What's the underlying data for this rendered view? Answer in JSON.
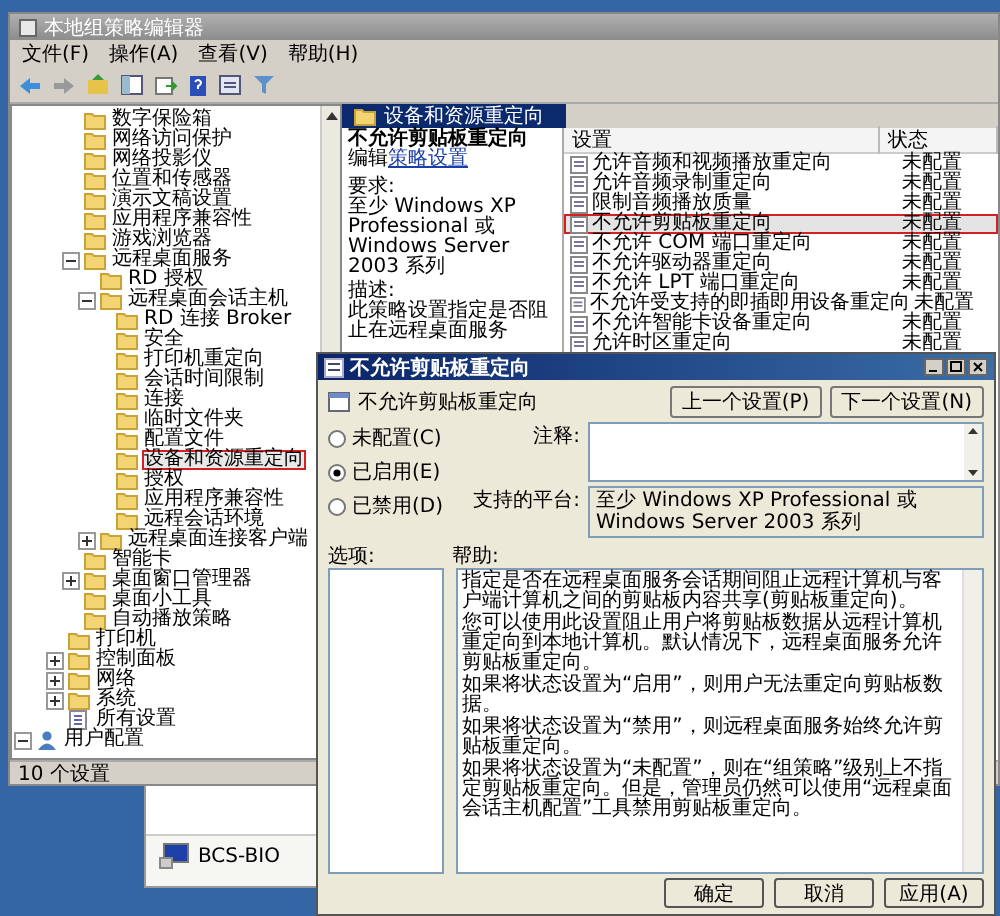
{
  "main_window": {
    "title": "本地组策略编辑器",
    "menu": [
      "文件(F)",
      "操作(A)",
      "查看(V)",
      "帮助(H)"
    ],
    "tree": {
      "components": [
        {
          "label": "数字保险箱",
          "selected": false
        },
        {
          "label": "网络访问保护",
          "selected": false
        },
        {
          "label": "网络投影仪",
          "selected": false
        },
        {
          "label": "位置和传感器",
          "selected": false
        },
        {
          "label": "演示文稿设置",
          "selected": false
        },
        {
          "label": "应用程序兼容性",
          "selected": false
        },
        {
          "label": "游戏浏览器",
          "selected": false
        },
        {
          "label": "远程桌面服务",
          "selected": false,
          "expanded": true,
          "children": [
            {
              "label": "RD 授权",
              "selected": false
            },
            {
              "label": "远程桌面会话主机",
              "selected": false,
              "expanded": true,
              "children": [
                {
                  "label": "RD 连接 Broker",
                  "selected": false
                },
                {
                  "label": "安全",
                  "selected": false
                },
                {
                  "label": "打印机重定向",
                  "selected": false
                },
                {
                  "label": "会话时间限制",
                  "selected": false
                },
                {
                  "label": "连接",
                  "selected": false
                },
                {
                  "label": "临时文件夹",
                  "selected": false
                },
                {
                  "label": "配置文件",
                  "selected": false
                },
                {
                  "label": "设备和资源重定向",
                  "selected": true
                },
                {
                  "label": "授权",
                  "selected": false
                },
                {
                  "label": "应用程序兼容性",
                  "selected": false
                },
                {
                  "label": "远程会话环境",
                  "selected": false
                }
              ]
            },
            {
              "label": "远程桌面连接客户端",
              "selected": false,
              "expanded": false
            }
          ]
        },
        {
          "label": "智能卡",
          "selected": false
        },
        {
          "label": "桌面窗口管理器",
          "selected": false,
          "expanded": false
        },
        {
          "label": "桌面小工具",
          "selected": false
        },
        {
          "label": "自动播放策略",
          "selected": false
        }
      ],
      "templates": [
        {
          "label": "打印机",
          "kind": "folder",
          "selected": false
        },
        {
          "label": "控制面板",
          "kind": "folder",
          "selected": false,
          "expanded": false
        },
        {
          "label": "网络",
          "kind": "folder",
          "selected": false,
          "expanded": false
        },
        {
          "label": "系统",
          "kind": "folder",
          "selected": false,
          "expanded": false
        },
        {
          "label": "所有设置",
          "kind": "settings",
          "selected": false
        }
      ],
      "roots": [
        {
          "label": "用户配置",
          "kind": "user",
          "selected": false,
          "expanded": true
        }
      ]
    },
    "details": {
      "header": "设备和资源重定向",
      "policy_title": "不允许剪贴板重定向",
      "edit_prefix": "编辑",
      "edit_link": "策略设置",
      "requirements_label": "要求:",
      "requirements": "至少 Windows XP Professional 或 Windows Server 2003 系列",
      "description_label": "描述:",
      "description": "此策略设置指定是否阻止在远程桌面服务"
    },
    "list": {
      "columns": [
        "设置",
        "状态"
      ],
      "rows": [
        {
          "name": "允许音频和视频播放重定向",
          "state": "未配置",
          "selected": false
        },
        {
          "name": "允许音频录制重定向",
          "state": "未配置",
          "selected": false
        },
        {
          "name": "限制音频播放质量",
          "state": "未配置",
          "selected": false
        },
        {
          "name": "不允许剪贴板重定向",
          "state": "未配置",
          "selected": true
        },
        {
          "name": "不允许 COM 端口重定向",
          "state": "未配置",
          "selected": false
        },
        {
          "name": "不允许驱动器重定向",
          "state": "未配置",
          "selected": false
        },
        {
          "name": "不允许 LPT 端口重定向",
          "state": "未配置",
          "selected": false
        },
        {
          "name": "不允许受支持的即插即用设备重定向",
          "state": "未配置",
          "selected": false
        },
        {
          "name": "不允许智能卡设备重定向",
          "state": "未配置",
          "selected": false
        },
        {
          "name": "允许时区重定向",
          "state": "未配置",
          "selected": false
        }
      ]
    },
    "status_bar": "10 个设置"
  },
  "background_window": {
    "computer": "BCS-BIO"
  },
  "dialog": {
    "title": "不允许剪贴板重定向",
    "setting_name": "不允许剪贴板重定向",
    "nav_buttons": [
      "上一个设置(P)",
      "下一个设置(N)"
    ],
    "options": [
      {
        "label": "未配置(C)",
        "selected": false
      },
      {
        "label": "已启用(E)",
        "selected": true
      },
      {
        "label": "已禁用(D)",
        "selected": false
      }
    ],
    "comment_label": "注释:",
    "platform_label": "支持的平台:",
    "platform": "至少 Windows XP Professional 或 Windows Server 2003 系列",
    "options_label": "选项:",
    "help_label": "帮助:",
    "help": [
      "指定是否在远程桌面服务会话期间阻止远程计算机与客户端计算机之间的剪贴板内容共享(剪贴板重定向)。",
      "您可以使用此设置阻止用户将剪贴板数据从远程计算机重定向到本地计算机。默认情况下，远程桌面服务允许剪贴板重定向。",
      "如果将状态设置为“启用”，则用户无法重定向剪贴板数据。",
      "如果将状态设置为“禁用”，则远程桌面服务始终允许剪贴板重定向。",
      "如果将状态设置为“未配置”，则在“组策略”级别上不指定剪贴板重定向。但是，管理员仍然可以使用“远程桌面会话主机配置”工具禁用剪贴板重定向。"
    ],
    "buttons": [
      "确定",
      "取消",
      "应用(A)"
    ]
  }
}
